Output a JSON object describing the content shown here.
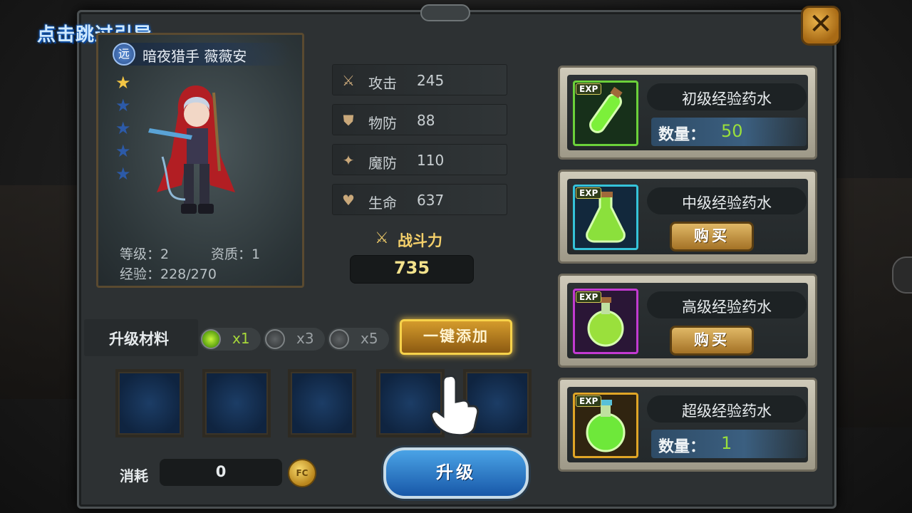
{
  "guide": {
    "skip_label": "点击跳过引导"
  },
  "close": {
    "label": "✕"
  },
  "hero": {
    "class_badge": "远",
    "name": "暗夜猎手 薇薇安",
    "stars_filled": 1,
    "stars_total": 5,
    "level_text": "等级：2",
    "aptitude_text": "资质：1",
    "exp_text": "经验：228/270"
  },
  "attributes": [
    {
      "icon": "sword-icon",
      "glyph": "⚔",
      "label": "攻击",
      "value": "245"
    },
    {
      "icon": "shield-icon",
      "glyph": "⛊",
      "label": "物防",
      "value": "88"
    },
    {
      "icon": "magic-star-icon",
      "glyph": "✦",
      "label": "魔防",
      "value": "110"
    },
    {
      "icon": "heart-icon",
      "glyph": "♥",
      "label": "生命",
      "value": "637"
    }
  ],
  "power": {
    "label": "战斗力",
    "value": "735"
  },
  "materials": {
    "title": "升级材料",
    "options": [
      {
        "label": "x1",
        "selected": true
      },
      {
        "label": "x3",
        "selected": false
      },
      {
        "label": "x5",
        "selected": false
      }
    ],
    "quick_add_label": "一键添加",
    "slot_count": 5
  },
  "cost": {
    "label": "消耗",
    "value": "0",
    "coin_label": "FC"
  },
  "upgrade_button": {
    "label": "升级"
  },
  "potions": [
    {
      "name": "初级经验药水",
      "tag": "EXP",
      "frame_color": "#6bd13a",
      "qty_label": "数量：",
      "quantity": "50",
      "buy_label": null
    },
    {
      "name": "中级经验药水",
      "tag": "EXP",
      "frame_color": "#35c3d9",
      "qty_label": null,
      "quantity": null,
      "buy_label": "购买"
    },
    {
      "name": "高级经验药水",
      "tag": "EXP",
      "frame_color": "#c23ad1",
      "qty_label": null,
      "quantity": null,
      "buy_label": "购买"
    },
    {
      "name": "超级经验药水",
      "tag": "EXP",
      "frame_color": "#e0a526",
      "qty_label": "数量：",
      "quantity": "1",
      "buy_label": null
    }
  ]
}
